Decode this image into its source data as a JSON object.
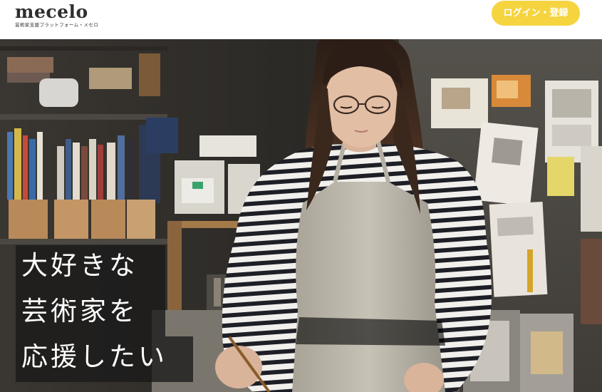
{
  "header": {
    "logo_text": "mecelo",
    "logo_subtitle": "芸術家支援プラットフォーム・メセロ",
    "login_label": "ログイン・登録"
  },
  "hero": {
    "tagline_lines": [
      "大好きな",
      "芸術家を",
      "応援したい"
    ],
    "image_icon": "artist-photo"
  },
  "colors": {
    "accent": "#f5d43f",
    "tagline_bg": "#1a1a1a",
    "logo_text": "#2e2e2e"
  }
}
